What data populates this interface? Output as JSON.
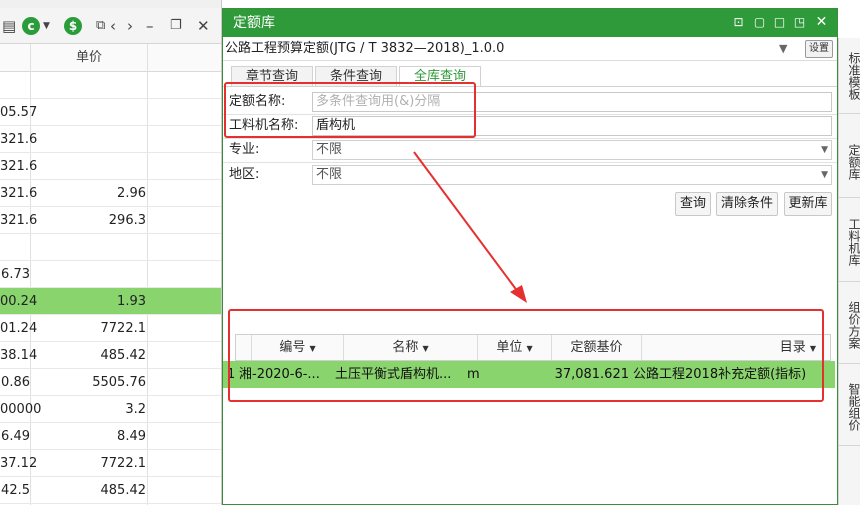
{
  "left_panel": {
    "header_unit": "单价",
    "rows": [
      {
        "c1": "",
        "c2": ""
      },
      {
        "c1": "05.57",
        "c2": ""
      },
      {
        "c1": "321.6",
        "c2": ""
      },
      {
        "c1": "321.6",
        "c2": ""
      },
      {
        "c1": "321.6",
        "c2": "2.96"
      },
      {
        "c1": "321.6",
        "c2": "296.3"
      },
      {
        "c1": "",
        "c2": ""
      },
      {
        "c1": "6.73",
        "c2": ""
      },
      {
        "c1": "00.24",
        "c2": "1.93"
      },
      {
        "c1": "01.24",
        "c2": "7722.1"
      },
      {
        "c1": "38.14",
        "c2": "485.42"
      },
      {
        "c1": "0.86",
        "c2": "5505.76"
      },
      {
        "c1": "00000",
        "c2": "3.2"
      },
      {
        "c1": "6.49",
        "c2": "8.49"
      },
      {
        "c1": "37.12",
        "c2": "7722.1"
      },
      {
        "c1": "42.5",
        "c2": "485.42"
      }
    ],
    "highlight_row_index": 8,
    "highlight_color": "#8ad46e"
  },
  "dialog": {
    "title": "定额库",
    "library": "公路工程预算定额(JTG / T 3832—2018)_1.0.0",
    "settings_label": "设置",
    "tabs": [
      "章节查询",
      "条件查询",
      "全库查询"
    ],
    "active_tab": 2,
    "fields": {
      "quota_name_label": "定额名称:",
      "quota_name_placeholder": "多条件查询用(&)分隔",
      "material_label": "工料机名称:",
      "material_value": "盾构机",
      "specialty_label": "专业:",
      "specialty_value": "不限",
      "region_label": "地区:",
      "region_value": "不限"
    },
    "buttons": {
      "query": "查询",
      "clear": "清除条件",
      "update": "更新库"
    },
    "grid": {
      "headers": {
        "code": "编号",
        "name": "名称",
        "unit": "单位",
        "base_price": "定额基价",
        "catalog": "目录"
      },
      "row": {
        "index": "1",
        "code": "湘-2020-6-...",
        "name": "土压平衡式盾构机...",
        "unit": "m",
        "base_price": "37,081.621",
        "catalog": "公路工程2018补充定额(指标)"
      }
    },
    "accent_color": "#2e9a3a"
  },
  "side_rail": [
    "标准模板",
    "定额库",
    "工料机库",
    "组价方案",
    "智能组价"
  ],
  "annotation_color": "#e53030"
}
